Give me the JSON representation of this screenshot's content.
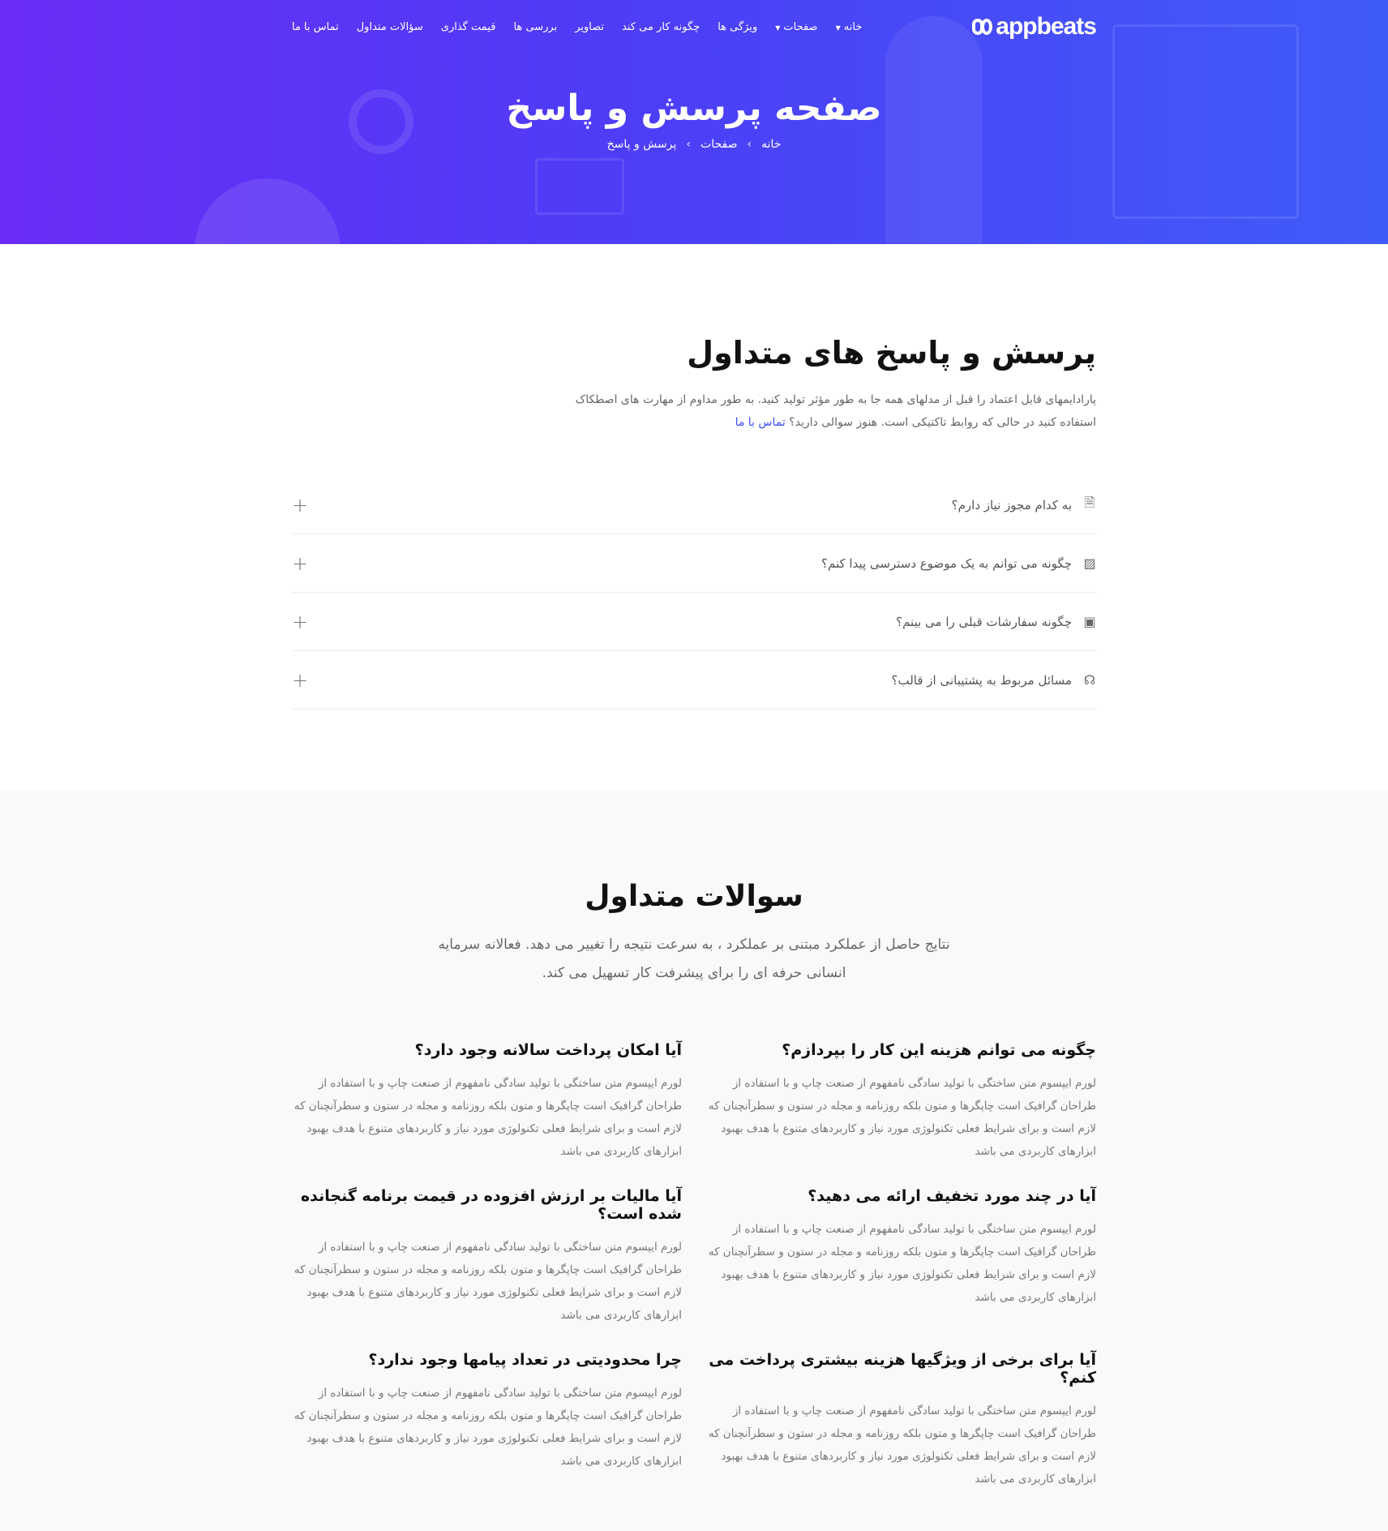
{
  "brand": {
    "name": "appbeats"
  },
  "nav": {
    "items": [
      {
        "label": "خانه",
        "dropdown": true
      },
      {
        "label": "صفحات",
        "dropdown": true
      },
      {
        "label": "ویژگی ها",
        "dropdown": false
      },
      {
        "label": "چگونه کار می کند",
        "dropdown": false
      },
      {
        "label": "تصاویر",
        "dropdown": false
      },
      {
        "label": "بررسی ها",
        "dropdown": false
      },
      {
        "label": "قیمت گذاری",
        "dropdown": false
      },
      {
        "label": "سؤالات متداول",
        "dropdown": false
      },
      {
        "label": "تماس با ما",
        "dropdown": false
      }
    ]
  },
  "hero": {
    "title": "صفحه پرسش و پاسخ",
    "breadcrumb": [
      "خانه",
      "صفحات",
      "پرسش و پاسخ"
    ],
    "separator": "›"
  },
  "faq": {
    "title": "پرسش و پاسخ های متداول",
    "description": "پارادایمهای قابل اعتماد را قبل از مدلهای همه جا به طور مؤثر تولید کنید. به طور مداوم از مهارت های اصطکاک استفاده کنید در حالی که روابط تاکتیکی است. هنوز سوالی دارید؟",
    "contact_link": "تماس با ما",
    "toggle_symbol": "+",
    "items": [
      {
        "question": "به کدام مجوز نیاز دارم؟",
        "icon": "document-icon",
        "glyph": "🗎"
      },
      {
        "question": "چگونه می توانم به یک موضوع دسترسی پیدا کنم؟",
        "icon": "image-icon",
        "glyph": "▨"
      },
      {
        "question": "چگونه سفارشات قبلی را می بینم؟",
        "icon": "wallet-icon",
        "glyph": "▣"
      },
      {
        "question": "مسائل مربوط به پشتیبانی از قالب؟",
        "icon": "headset-icon",
        "glyph": "☊"
      }
    ]
  },
  "common": {
    "title": "سوالات متداول",
    "subtitle": "نتایج حاصل از عملکرد مبتنی بر عملکرد ، به سرعت نتیجه را تغییر می دهد. فعالانه سرمایه انسانی حرفه ای را برای پیشرفت کار تسهیل می کند.",
    "items": [
      {
        "question": "چگونه می توانم هزینه این کار را بپردازم؟",
        "answer": "لورم ایپسوم متن ساختگی با تولید سادگی نامفهوم از صنعت چاپ و با استفاده از طراحان گرافیک است چاپگرها و متون بلکه روزنامه و مجله در ستون و سطرآنچنان که لازم است و برای شرایط فعلی تکنولوژی مورد نیاز و کاربردهای متنوع با هدف بهبود ابزارهای کاربردی می باشد"
      },
      {
        "question": "آیا امکان پرداخت سالانه وجود دارد؟",
        "answer": "لورم ایپسوم متن ساختگی با تولید سادگی نامفهوم از صنعت چاپ و با استفاده از طراحان گرافیک است چاپگرها و متون بلکه روزنامه و مجله در ستون و سطرآنچنان که لازم است و برای شرایط فعلی تکنولوژی مورد نیاز و کاربردهای متنوع با هدف بهبود ابزارهای کاربردی می باشد"
      },
      {
        "question": "آیا در چند مورد تخفیف ارائه می دهید؟",
        "answer": "لورم ایپسوم متن ساختگی با تولید سادگی نامفهوم از صنعت چاپ و با استفاده از طراحان گرافیک است چاپگرها و متون بلکه روزنامه و مجله در ستون و سطرآنچنان که لازم است و برای شرایط فعلی تکنولوژی مورد نیاز و کاربردهای متنوع با هدف بهبود ابزارهای کاربردی می باشد"
      },
      {
        "question": "آیا مالیات بر ارزش افزوده در قیمت برنامه گنجانده شده است؟",
        "answer": "لورم ایپسوم متن ساختگی با تولید سادگی نامفهوم از صنعت چاپ و با استفاده از طراحان گرافیک است چاپگرها و متون بلکه روزنامه و مجله در ستون و سطرآنچنان که لازم است و برای شرایط فعلی تکنولوژی مورد نیاز و کاربردهای متنوع با هدف بهبود ابزارهای کاربردی می باشد"
      },
      {
        "question": "آیا برای برخی از ویژگیها هزینه بیشتری پرداخت می کنم؟",
        "answer": "لورم ایپسوم متن ساختگی با تولید سادگی نامفهوم از صنعت چاپ و با استفاده از طراحان گرافیک است چاپگرها و متون بلکه روزنامه و مجله در ستون و سطرآنچنان که لازم است و برای شرایط فعلی تکنولوژی مورد نیاز و کاربردهای متنوع با هدف بهبود ابزارهای کاربردی می باشد"
      },
      {
        "question": "چرا محدودیتی در تعداد پیامها وجود ندارد؟",
        "answer": "لورم ایپسوم متن ساختگی با تولید سادگی نامفهوم از صنعت چاپ و با استفاده از طراحان گرافیک است چاپگرها و متون بلکه روزنامه و مجله در ستون و سطرآنچنان که لازم است و برای شرایط فعلی تکنولوژی مورد نیاز و کاربردهای متنوع با هدف بهبود ابزارهای کاربردی می باشد"
      }
    ]
  },
  "colors": {
    "accent": "#3b4cf5",
    "hero_start": "#6a2cf6",
    "hero_end": "#3f5cf8",
    "light_bg": "#f8f9fa"
  }
}
